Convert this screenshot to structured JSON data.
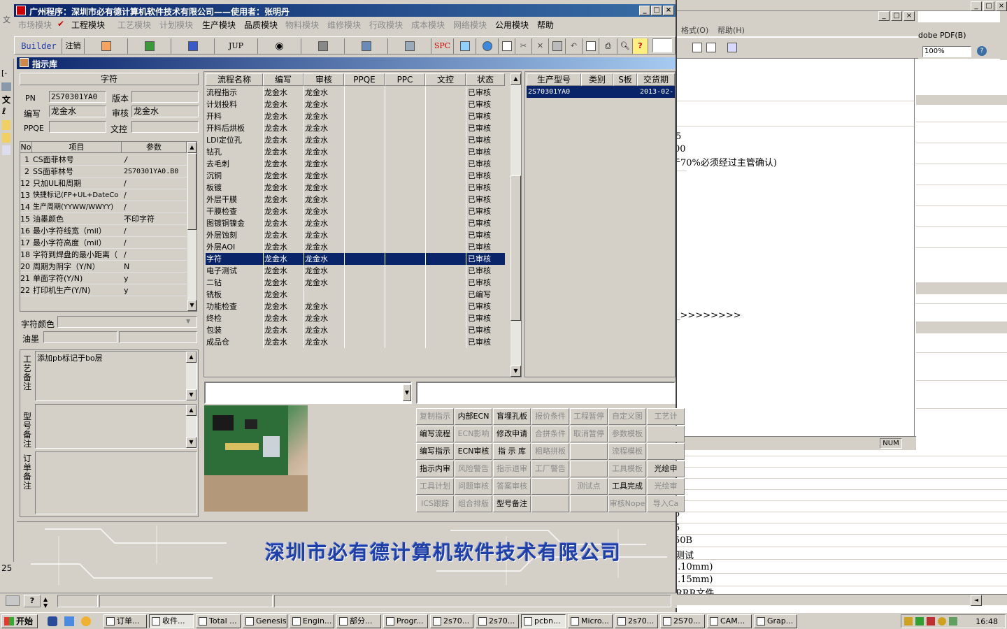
{
  "colors": {
    "title_blue": "#0a246a",
    "selection": "#0a246a",
    "banner_blue": "#1e3ea8",
    "face": "#d4d0c8"
  },
  "window": {
    "title": "广州程序：深圳市必有德计算机软件技术有限公司——使用者：张明丹",
    "controls": [
      "_",
      "□",
      "×"
    ]
  },
  "menu": [
    {
      "label": "市场模块",
      "dim": true
    },
    {
      "label": "工程模块",
      "dim": false,
      "checked": true
    },
    {
      "label": "工艺模块",
      "dim": true
    },
    {
      "label": "计划模块",
      "dim": true
    },
    {
      "label": "生产模块",
      "dim": false
    },
    {
      "label": "品质模块",
      "dim": false
    },
    {
      "label": "物料模块",
      "dim": true
    },
    {
      "label": "维修模块",
      "dim": true
    },
    {
      "label": "行政模块",
      "dim": true
    },
    {
      "label": "成本模块",
      "dim": true
    },
    {
      "label": "网络模块",
      "dim": true
    },
    {
      "label": "公用模块",
      "dim": false
    },
    {
      "label": "帮助",
      "dim": false
    }
  ],
  "toolbar": {
    "builder": "Builder",
    "logout": "注销",
    "jup": "JUP",
    "spc": "SPC",
    "icons": [
      "powerpoint-icon",
      "excel-icon",
      "word-icon",
      "eye-icon",
      "database-icon",
      "network-icon",
      "computer-icon",
      "refresh-icon",
      "globe-icon",
      "new-icon",
      "cut-icon",
      "delete-icon",
      "save-icon",
      "undo-icon",
      "preview-icon",
      "print-icon",
      "find-icon",
      "help-icon"
    ]
  },
  "inner_window": {
    "title": "指示库"
  },
  "left": {
    "section_title": "字符",
    "pn_label": "PN",
    "pn_value": "2S70301YA0",
    "version_label": "版本",
    "version_value": "",
    "writer_label": "编写",
    "writer_value": "龙金水",
    "reviewer_label": "审核",
    "reviewer_value": "龙金水",
    "ppqe_label": "PPQE",
    "ppqe_value": "",
    "doc_control_label": "文控",
    "doc_control_value": "",
    "param_headers": [
      "No",
      "项目",
      "参数"
    ],
    "params": [
      {
        "no": "1",
        "item": "CS面菲林号",
        "value": "/"
      },
      {
        "no": "2",
        "item": "SS面菲林号",
        "value": "2S70301YA0.B0"
      },
      {
        "no": "12",
        "item": "只加UL和周期",
        "value": "/"
      },
      {
        "no": "13",
        "item": "快捷标记(FP+UL+DateCo",
        "value": "/"
      },
      {
        "no": "14",
        "item": "生产周期(YYWW/WWYY)",
        "value": "/"
      },
      {
        "no": "15",
        "item": "油墨颜色",
        "value": "不印字符"
      },
      {
        "no": "16",
        "item": "最小字符线宽（mil）",
        "value": "/"
      },
      {
        "no": "17",
        "item": "最小字符高度（mil）",
        "value": "/"
      },
      {
        "no": "18",
        "item": "字符到焊盘的最小距离（",
        "value": "/"
      },
      {
        "no": "20",
        "item": "周期为阴字（Y/N）",
        "value": "N"
      },
      {
        "no": "21",
        "item": "单面字符(Y/N)",
        "value": "y"
      },
      {
        "no": "22",
        "item": "打印机生产(Y/N)",
        "value": "y"
      }
    ],
    "char_color_label": "字符颜色",
    "ink_label": "油墨",
    "craft_note_label": "工艺备注",
    "craft_note_value": "添加pb标记于bo层",
    "model_note_label": "型号备注",
    "order_note_label": "订单备注"
  },
  "process": {
    "headers": [
      "流程名称",
      "编写",
      "审核",
      "PPQE",
      "PPC",
      "文控",
      "状态"
    ],
    "rows": [
      {
        "name": "流程指示",
        "writer": "龙金水",
        "reviewer": "龙金水",
        "status": "已审核"
      },
      {
        "name": "计划投料",
        "writer": "龙金水",
        "reviewer": "龙金水",
        "status": "已审核"
      },
      {
        "name": "开料",
        "writer": "龙金水",
        "reviewer": "龙金水",
        "status": "已审核"
      },
      {
        "name": "开料后烘板",
        "writer": "龙金水",
        "reviewer": "龙金水",
        "status": "已审核"
      },
      {
        "name": "LDI定位孔",
        "writer": "龙金水",
        "reviewer": "龙金水",
        "status": "已审核"
      },
      {
        "name": "钻孔",
        "writer": "龙金水",
        "reviewer": "龙金水",
        "status": "已审核"
      },
      {
        "name": "去毛刺",
        "writer": "龙金水",
        "reviewer": "龙金水",
        "status": "已审核"
      },
      {
        "name": "沉铜",
        "writer": "龙金水",
        "reviewer": "龙金水",
        "status": "已审核"
      },
      {
        "name": "板镀",
        "writer": "龙金水",
        "reviewer": "龙金水",
        "status": "已审核"
      },
      {
        "name": "外层干膜",
        "writer": "龙金水",
        "reviewer": "龙金水",
        "status": "已审核"
      },
      {
        "name": "干膜检查",
        "writer": "龙金水",
        "reviewer": "龙金水",
        "status": "已审核"
      },
      {
        "name": "图镀铜镍金",
        "writer": "龙金水",
        "reviewer": "龙金水",
        "status": "已审核"
      },
      {
        "name": "外层蚀刻",
        "writer": "龙金水",
        "reviewer": "龙金水",
        "status": "已审核"
      },
      {
        "name": "外层AOI",
        "writer": "龙金水",
        "reviewer": "龙金水",
        "status": "已审核"
      },
      {
        "name": "字符",
        "writer": "龙金水",
        "reviewer": "龙金水",
        "status": "已审核",
        "selected": true
      },
      {
        "name": "电子测试",
        "writer": "龙金水",
        "reviewer": "龙金水",
        "status": "已审核"
      },
      {
        "name": "二钻",
        "writer": "龙金水",
        "reviewer": "龙金水",
        "status": "已审核"
      },
      {
        "name": "铣板",
        "writer": "龙金水",
        "reviewer": "",
        "status": "已编写"
      },
      {
        "name": "功能检查",
        "writer": "龙金水",
        "reviewer": "龙金水",
        "status": "已审核"
      },
      {
        "name": "终检",
        "writer": "龙金水",
        "reviewer": "龙金水",
        "status": "已审核"
      },
      {
        "name": "包装",
        "writer": "龙金水",
        "reviewer": "龙金水",
        "status": "已审核"
      },
      {
        "name": "成品仓",
        "writer": "龙金水",
        "reviewer": "龙金水",
        "status": "已审核"
      }
    ]
  },
  "model": {
    "headers": [
      "生产型号",
      "类别",
      "S板",
      "交货期"
    ],
    "rows": [
      {
        "model": "2S70301YA0",
        "category": "",
        "s_board": "",
        "date": "2013-02-"
      }
    ]
  },
  "actions": [
    [
      {
        "label": "复制指示",
        "dim": true
      },
      {
        "label": "内部ECN",
        "dim": false
      },
      {
        "label": "盲埋孔板",
        "dim": false
      },
      {
        "label": "报价条件",
        "dim": true
      },
      {
        "label": "工程暂停",
        "dim": true
      },
      {
        "label": "自定义图",
        "dim": true
      },
      {
        "label": "工艺计",
        "dim": true
      }
    ],
    [
      {
        "label": "编写流程",
        "dim": false
      },
      {
        "label": "ECN影响",
        "dim": true
      },
      {
        "label": "修改申请",
        "dim": false
      },
      {
        "label": "合拼条件",
        "dim": true
      },
      {
        "label": "取消暂停",
        "dim": true
      },
      {
        "label": "参数模板",
        "dim": true
      },
      {
        "label": "",
        "dim": true
      }
    ],
    [
      {
        "label": "编写指示",
        "dim": false
      },
      {
        "label": "ECN审核",
        "dim": false
      },
      {
        "label": "指 示 库",
        "dim": false
      },
      {
        "label": "粗略拼板",
        "dim": true
      },
      {
        "label": "",
        "dim": true
      },
      {
        "label": "流程模板",
        "dim": true
      },
      {
        "label": "",
        "dim": true
      }
    ],
    [
      {
        "label": "指示内审",
        "dim": false
      },
      {
        "label": "风险警告",
        "dim": true
      },
      {
        "label": "指示退审",
        "dim": true
      },
      {
        "label": "工厂警告",
        "dim": true
      },
      {
        "label": "",
        "dim": true
      },
      {
        "label": "工具模板",
        "dim": true
      },
      {
        "label": "光绘申",
        "dim": false
      }
    ],
    [
      {
        "label": "工具计划",
        "dim": true
      },
      {
        "label": "问题审核",
        "dim": true
      },
      {
        "label": "答案审核",
        "dim": true
      },
      {
        "label": "",
        "dim": true
      },
      {
        "label": "测试点",
        "dim": true
      },
      {
        "label": "工具完成",
        "dim": false
      },
      {
        "label": "光绘审",
        "dim": true
      }
    ],
    [
      {
        "label": "ICS跟踪",
        "dim": true
      },
      {
        "label": "组合排版",
        "dim": true
      },
      {
        "label": "型号备注",
        "dim": false
      },
      {
        "label": "",
        "dim": true
      },
      {
        "label": "",
        "dim": true
      },
      {
        "label": "审核Nope",
        "dim": true
      },
      {
        "label": "导入Ca",
        "dim": true
      }
    ]
  ],
  "banner": "深圳市必有德计算机软件技术有限公司",
  "background_app": {
    "menus": [
      "格式(O)",
      "帮助(H)"
    ],
    "acrobat_label": "dobe PDF(B)",
    "zoom": "100%",
    "status_num": "NUM",
    "doc_lines": [
      "5",
      "00",
      "于70%必须经过主管确认)",
      "_>>>>>>>>"
    ],
    "sheet_lines": [
      "5",
      "5",
      "50B",
      "测试",
      ").10mm)",
      ").15mm)",
      "RRR文件"
    ]
  },
  "taskbar": {
    "start": "开始",
    "tasks": [
      "订单...",
      "收件...",
      "Total ...",
      "Genesis",
      "Engin...",
      "部分...",
      "Progr...",
      "2s70...",
      "2s70...",
      "pcbn...",
      "Micro...",
      "2s70...",
      "2S70...",
      "CAM...",
      "Grap..."
    ],
    "clock": "16:48"
  }
}
